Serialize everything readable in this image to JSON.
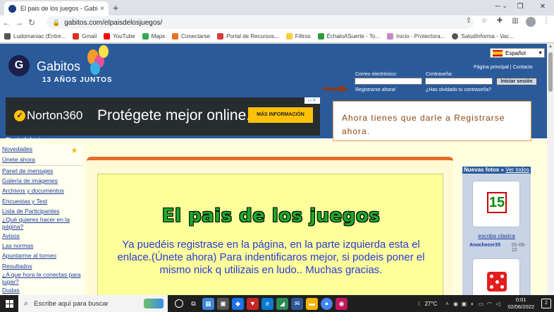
{
  "browser": {
    "tab_title": "El pais de los juegos - Gabitos",
    "tab_close": "×",
    "new_tab": "+",
    "url": "gabitos.com/elpaisdelosjuegos/",
    "bookmarks": [
      {
        "label": "Ludomaniac (Entre...",
        "color": "#555"
      },
      {
        "label": "Gmail",
        "color": "#d93025"
      },
      {
        "label": "YouTube",
        "color": "#ff0000"
      },
      {
        "label": "Maps",
        "color": "#34a853"
      },
      {
        "label": "Conectarse",
        "color": "#e8711c"
      },
      {
        "label": "Portal de Recursos...",
        "color": "#d33c3c"
      },
      {
        "label": "Filtros",
        "color": "#f9ce3c"
      },
      {
        "label": "ÉchaloASuerte - To...",
        "color": "#2e9d3a"
      },
      {
        "label": "Inicio - Protectora...",
        "color": "#c888c8"
      },
      {
        "label": "SaludInforma - Vac...",
        "color": "#555"
      }
    ]
  },
  "header": {
    "logo_letter": "G",
    "logo_text": "Gabitos",
    "logo_sub": "13 AÑOS JUNTOS",
    "language": "Español",
    "link_home": "Página principal",
    "link_sep": "|",
    "link_contact": "Contacto",
    "email_label": "Correo electrónico:",
    "password_label": "Contraseña:",
    "login_button": "Iniciar sesión",
    "register_link": "Registrarse ahora!",
    "forgot_link": "¿Has olvidado tu contraseña?"
  },
  "ad": {
    "brand": "Norton360",
    "headline": "Protégete mejor online.",
    "cta": "MÁS INFORMACIÓN",
    "adchoices": "▷✕"
  },
  "callout": {
    "text": "Ahora tienes que darle a Registrarse ahora."
  },
  "section_title": "El pais de los juegos",
  "leftnav": {
    "items": [
      "Novedades",
      "Únete ahora",
      "Panel de mensajes",
      "Galería de imágenes",
      "Archivos y documentos",
      "Encuestas y Test",
      "Lista de Participantes",
      "¿Qué quieres hacer en la página?",
      "Avisos",
      "Las normas",
      "Apuntarme al torneo",
      "Resultados",
      "¿A que hora te conectas para jugar?",
      "Dudas"
    ]
  },
  "main": {
    "title": "El pais de los juegos",
    "welcome": "Ya puedéis registrase en la página, en la parte izquierda esta el enlace.(Únete ahora) Para indentificaros mejor, si podeis poner el mismo nick q utilizais en ludo.. Muchas gracias."
  },
  "rightcol": {
    "header": "Nuevas fotos",
    "header_link": "Ver todos",
    "photo1": {
      "glyph": "15",
      "name": "escoba clasica",
      "user": "Anochecer35",
      "date": "01-06-22"
    }
  },
  "taskbar": {
    "search_placeholder": "Escribe aquí para buscar",
    "weather": "27°C",
    "time": "0:01",
    "date": "02/06/2022",
    "notifications": "2"
  }
}
